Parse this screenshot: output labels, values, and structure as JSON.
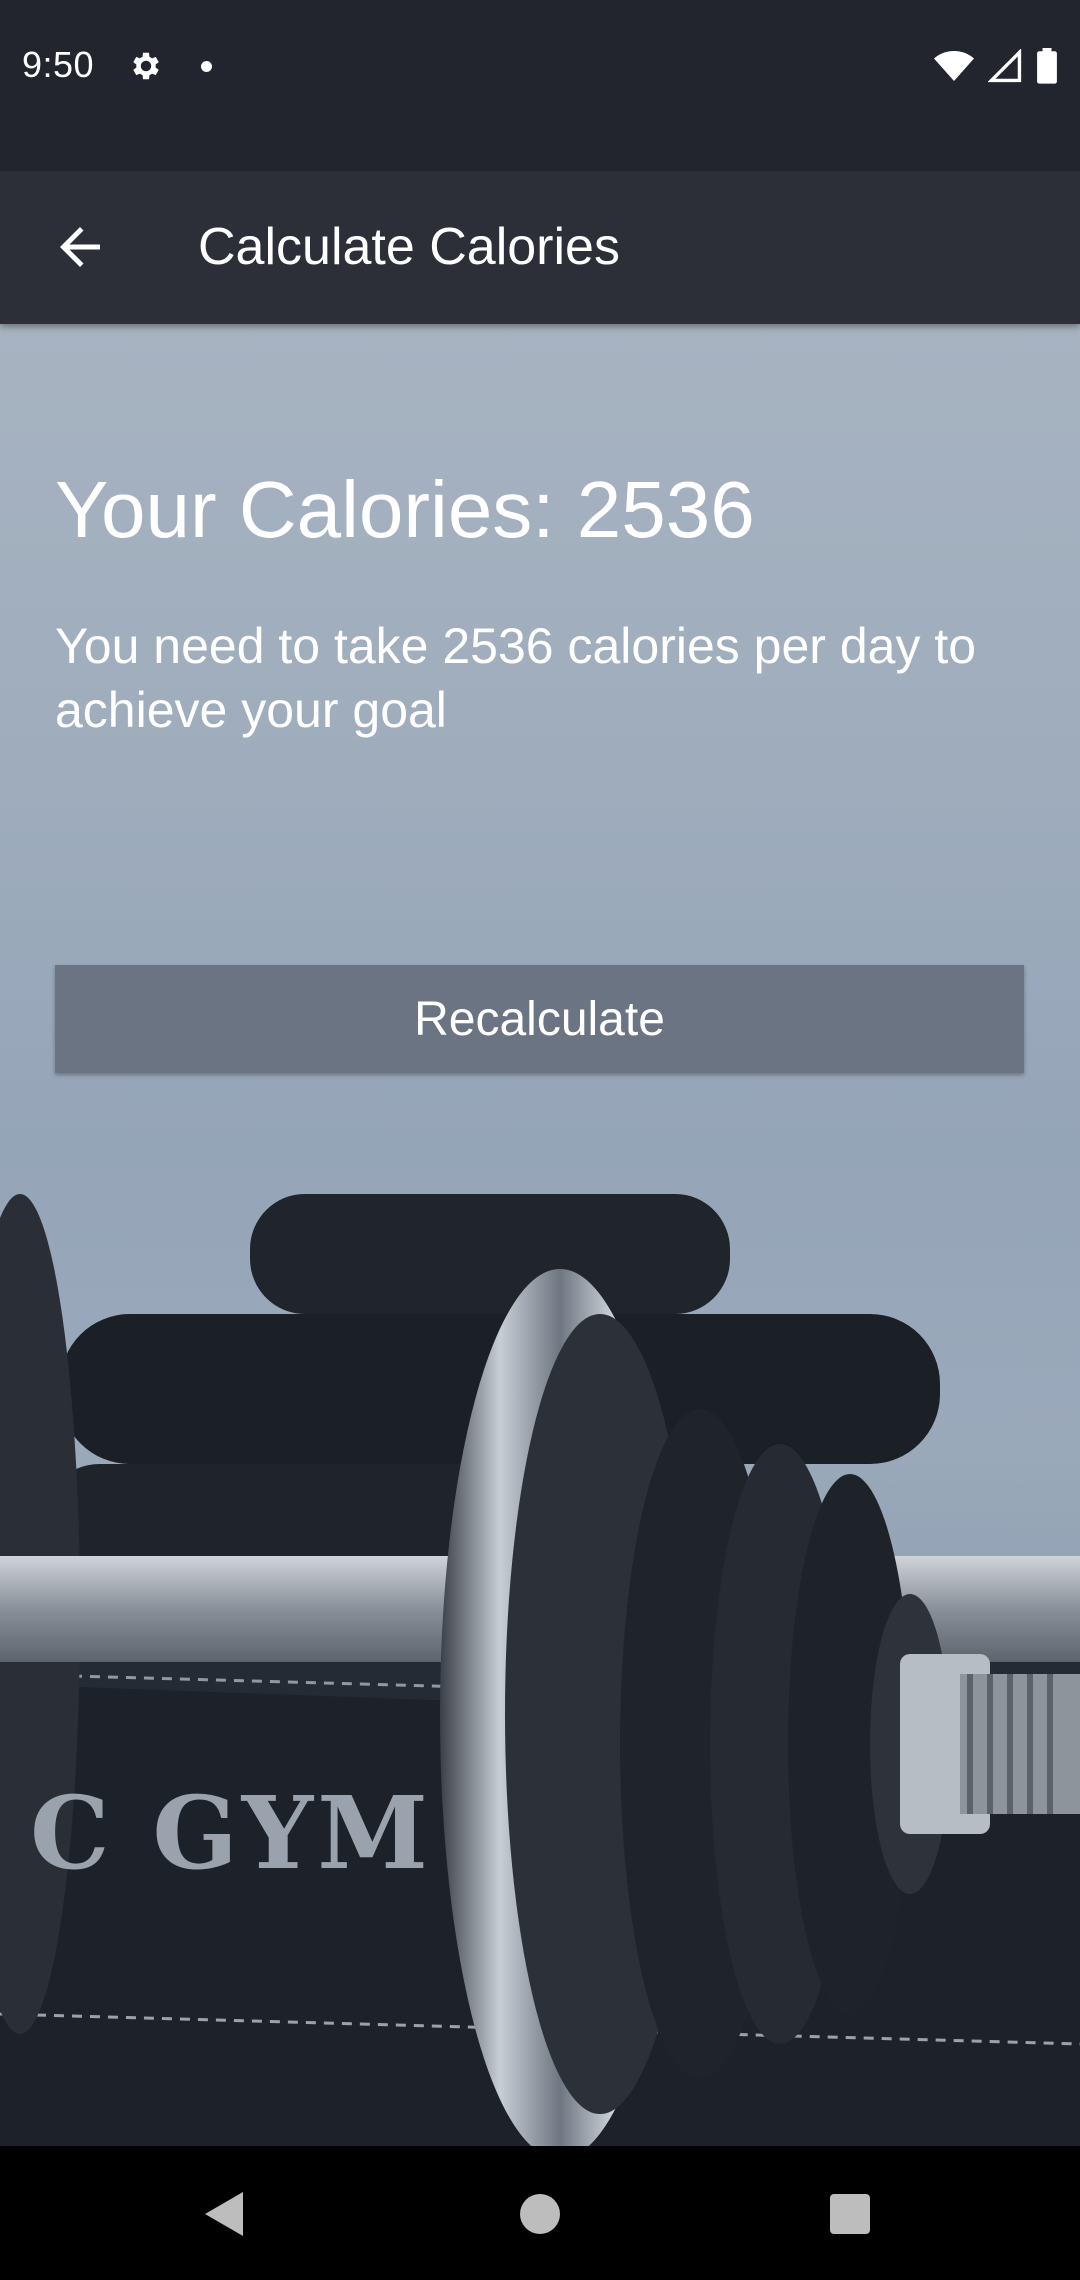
{
  "status_bar": {
    "time": "9:50",
    "icons": [
      "gear-icon",
      "notification-dot-icon",
      "wifi-icon",
      "signal-icon",
      "battery-icon"
    ]
  },
  "app_bar": {
    "title": "Calculate Calories",
    "back_icon": "arrow-back-icon"
  },
  "result": {
    "heading": "Your Calories: 2536",
    "description": "You need to take 2536 calories per day to achieve your goal"
  },
  "actions": {
    "recalculate_label": "Recalculate"
  },
  "background": {
    "logo_text": "C GYM"
  },
  "nav_bar": {
    "icons": [
      "nav-back-icon",
      "nav-home-icon",
      "nav-recents-icon"
    ]
  },
  "colors": {
    "status_bar": "#22252e",
    "app_bar": "#2c2f38",
    "button": "#6a7482",
    "text": "#ffffff"
  }
}
